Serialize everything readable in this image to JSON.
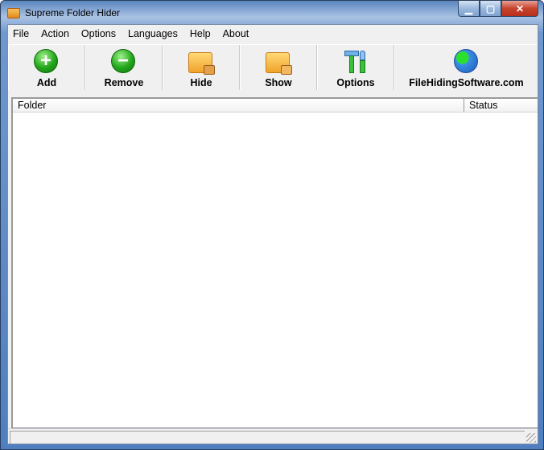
{
  "window": {
    "title": "Supreme Folder Hider",
    "min": "▁",
    "max": "▢",
    "close": "✕"
  },
  "menu": [
    "File",
    "Action",
    "Options",
    "Languages",
    "Help",
    "About"
  ],
  "toolbar": {
    "add": "Add",
    "remove": "Remove",
    "hide": "Hide",
    "show": "Show",
    "options": "Options",
    "site": "FileHidingSoftware.com"
  },
  "list": {
    "columns": [
      "Folder",
      "Status"
    ],
    "rows": []
  }
}
